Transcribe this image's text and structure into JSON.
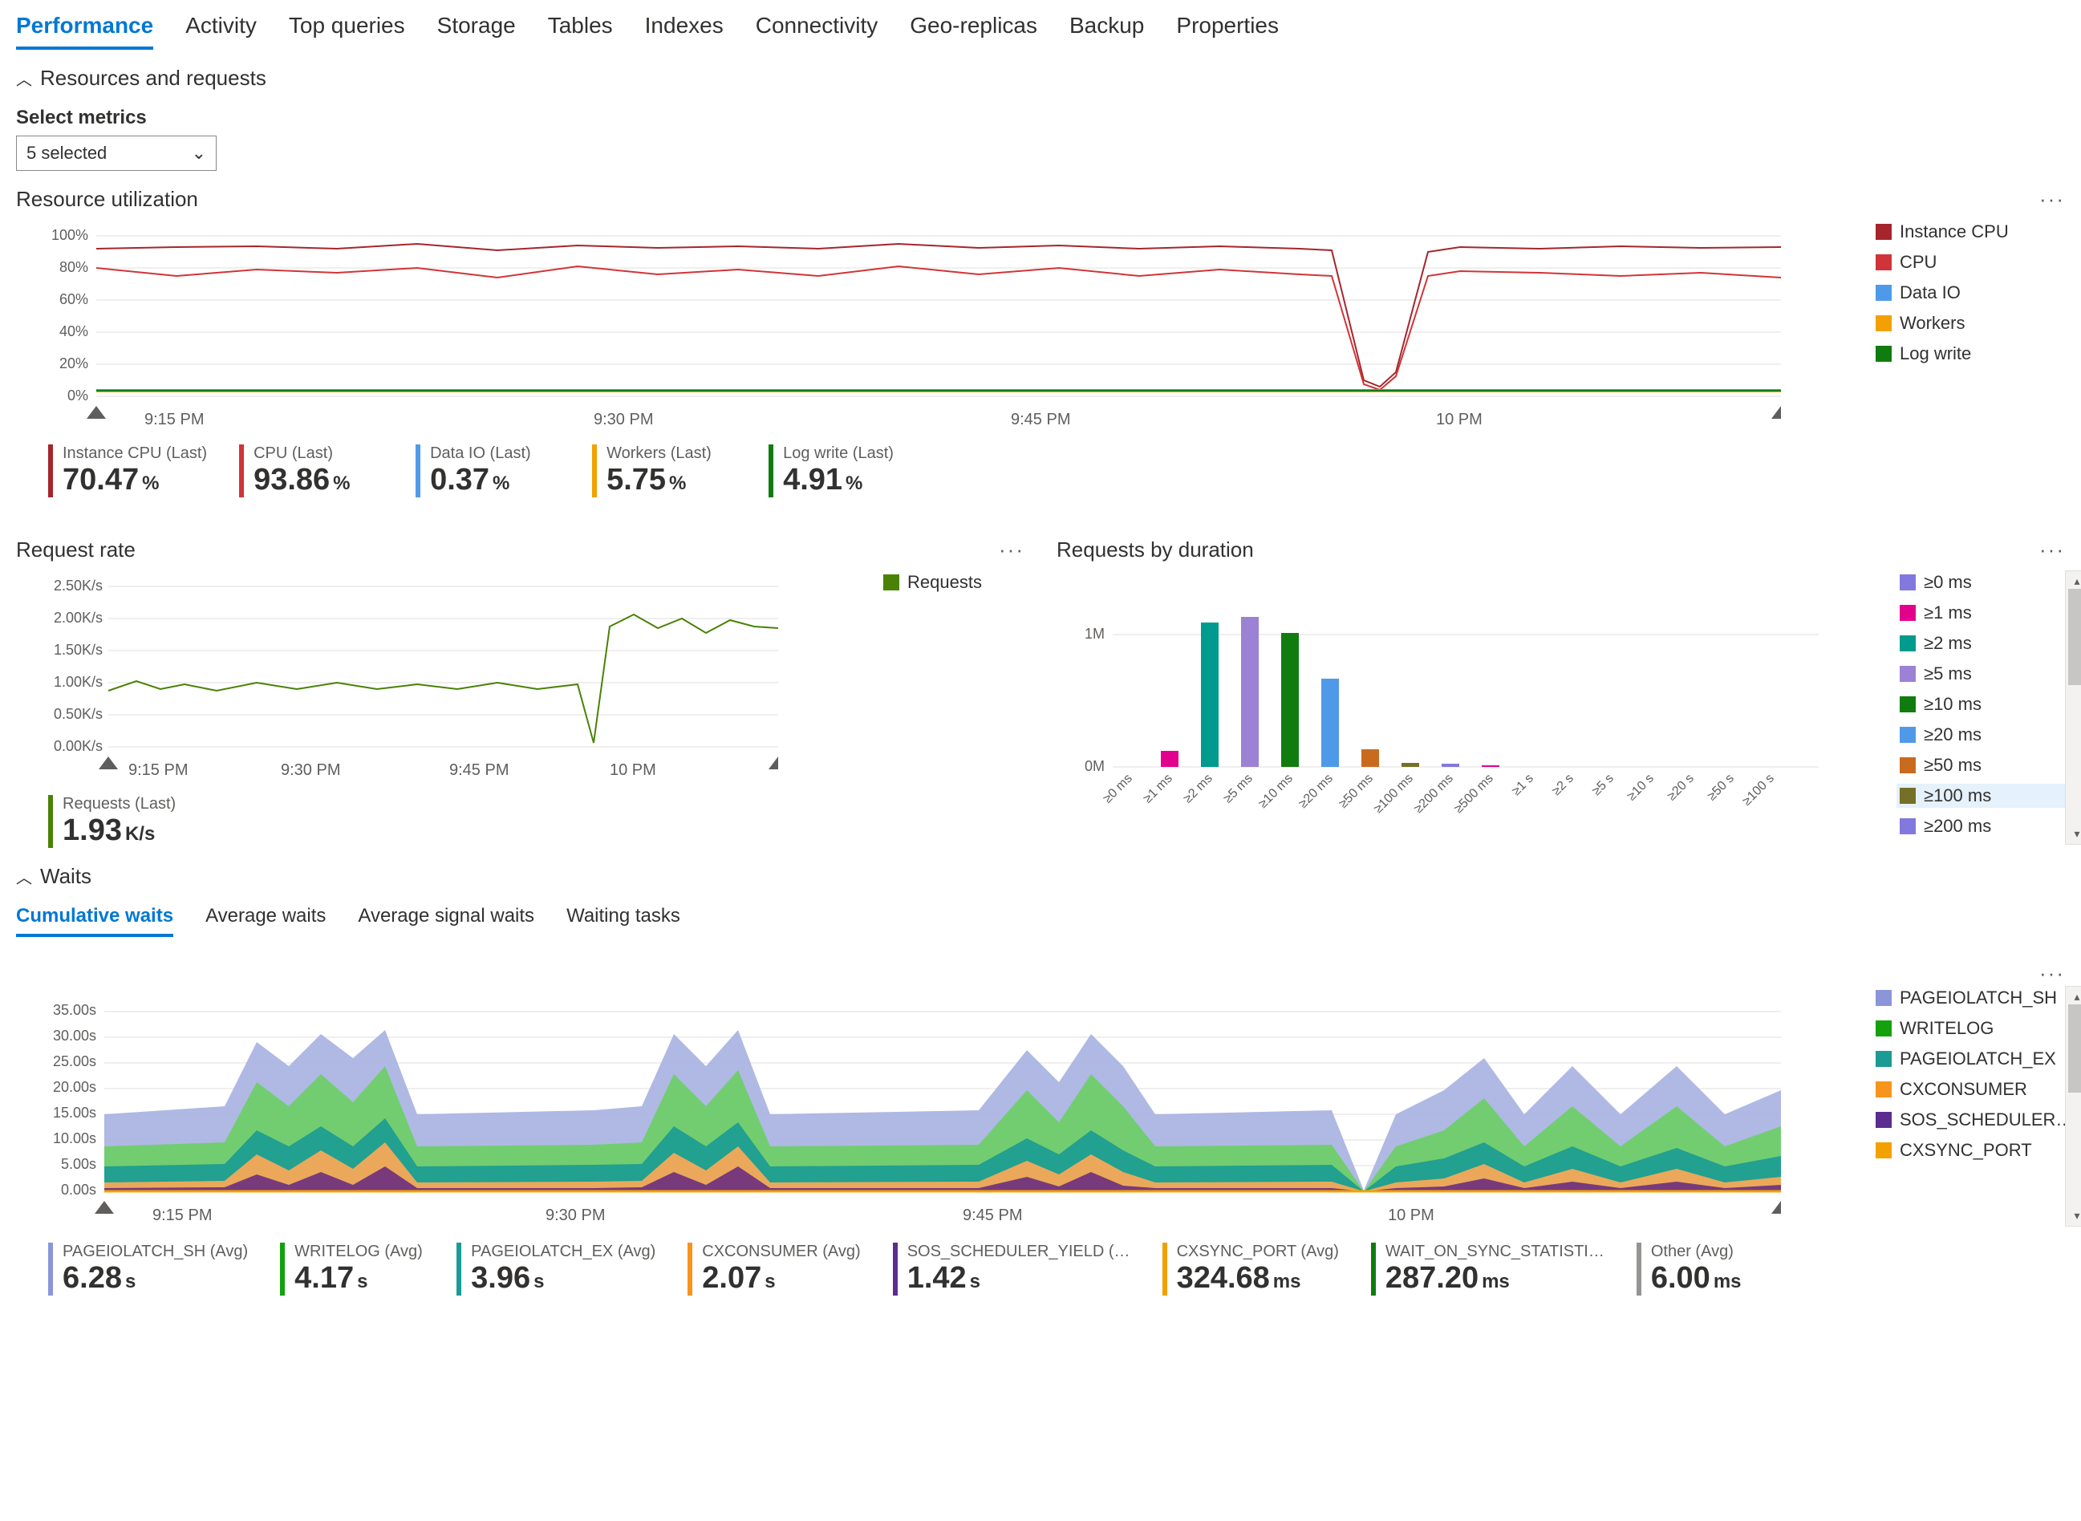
{
  "tabs": [
    "Performance",
    "Activity",
    "Top queries",
    "Storage",
    "Tables",
    "Indexes",
    "Connectivity",
    "Geo-replicas",
    "Backup",
    "Properties"
  ],
  "active_tab": "Performance",
  "sections": {
    "resources": {
      "title": "Resources and requests",
      "select_label": "Select metrics",
      "select_value": "5 selected"
    },
    "waits": {
      "title": "Waits"
    }
  },
  "wait_subtabs": [
    "Cumulative waits",
    "Average waits",
    "Average signal waits",
    "Waiting tasks"
  ],
  "wait_subtab_active": "Cumulative waits",
  "resource_util": {
    "title": "Resource utilization",
    "legend": [
      {
        "label": "Instance CPU",
        "color": "#a4262c"
      },
      {
        "label": "CPU",
        "color": "#d13438"
      },
      {
        "label": "Data IO",
        "color": "#4f9ae8"
      },
      {
        "label": "Workers",
        "color": "#f2a100"
      },
      {
        "label": "Log write",
        "color": "#107c10"
      }
    ],
    "metrics": [
      {
        "label": "Instance CPU (Last)",
        "value": "70.47",
        "unit": "%",
        "color": "#a4262c"
      },
      {
        "label": "CPU (Last)",
        "value": "93.86",
        "unit": "%",
        "color": "#d13438"
      },
      {
        "label": "Data IO (Last)",
        "value": "0.37",
        "unit": "%",
        "color": "#4f9ae8"
      },
      {
        "label": "Workers (Last)",
        "value": "5.75",
        "unit": "%",
        "color": "#f2a100"
      },
      {
        "label": "Log write (Last)",
        "value": "4.91",
        "unit": "%",
        "color": "#107c10"
      }
    ],
    "xlabels": [
      "9:15 PM",
      "9:30 PM",
      "9:45 PM",
      "10 PM"
    ],
    "yticks": [
      "0%",
      "20%",
      "40%",
      "60%",
      "80%",
      "100%"
    ]
  },
  "request_rate": {
    "title": "Request rate",
    "legend": [
      {
        "label": "Requests",
        "color": "#498205"
      }
    ],
    "metrics": [
      {
        "label": "Requests (Last)",
        "value": "1.93",
        "unit": "K/s",
        "color": "#498205"
      }
    ],
    "xlabels": [
      "9:15 PM",
      "9:30 PM",
      "9:45 PM",
      "10 PM"
    ],
    "yticks": [
      "0.00K/s",
      "0.50K/s",
      "1.00K/s",
      "1.50K/s",
      "2.00K/s",
      "2.50K/s"
    ]
  },
  "requests_by_duration": {
    "title": "Requests by duration",
    "legend": [
      {
        "label": "≥0 ms",
        "color": "#8378de"
      },
      {
        "label": "≥1 ms",
        "color": "#e3008c"
      },
      {
        "label": "≥2 ms",
        "color": "#009b8e"
      },
      {
        "label": "≥5 ms",
        "color": "#9b82d4"
      },
      {
        "label": "≥10 ms",
        "color": "#107c10"
      },
      {
        "label": "≥20 ms",
        "color": "#4f9ae8"
      },
      {
        "label": "≥50 ms",
        "color": "#c96b1f"
      },
      {
        "label": "≥100 ms",
        "color": "#757028",
        "hl": true
      },
      {
        "label": "≥200 ms",
        "color": "#8378de"
      }
    ],
    "yticks": [
      "0M",
      "1M"
    ],
    "xlabels": [
      "≥0 ms",
      "≥1 ms",
      "≥2 ms",
      "≥5 ms",
      "≥10 ms",
      "≥20 ms",
      "≥50 ms",
      "≥100 ms",
      "≥200 ms",
      "≥500 ms",
      "≥1 s",
      "≥2 s",
      "≥5 s",
      "≥10 s",
      "≥20 s",
      "≥50 s",
      "≥100 s"
    ]
  },
  "waits_chart": {
    "legend": [
      {
        "label": "PAGEIOLATCH_SH",
        "color": "#8a96d9"
      },
      {
        "label": "WRITELOG",
        "color": "#13a10e"
      },
      {
        "label": "PAGEIOLATCH_EX",
        "color": "#1a9b94"
      },
      {
        "label": "CXCONSUMER",
        "color": "#f7941d"
      },
      {
        "label": "SOS_SCHEDULER…",
        "color": "#5b2d8e"
      },
      {
        "label": "CXSYNC_PORT",
        "color": "#f2a100"
      }
    ],
    "xlabels": [
      "9:15 PM",
      "9:30 PM",
      "9:45 PM",
      "10 PM"
    ],
    "yticks": [
      "0.00s",
      "5.00s",
      "10.00s",
      "15.00s",
      "20.00s",
      "25.00s",
      "30.00s",
      "35.00s"
    ],
    "metrics": [
      {
        "label": "PAGEIOLATCH_SH (Avg)",
        "value": "6.28",
        "unit": "s",
        "color": "#8a96d9"
      },
      {
        "label": "WRITELOG (Avg)",
        "value": "4.17",
        "unit": "s",
        "color": "#13a10e"
      },
      {
        "label": "PAGEIOLATCH_EX (Avg)",
        "value": "3.96",
        "unit": "s",
        "color": "#1a9b94"
      },
      {
        "label": "CXCONSUMER (Avg)",
        "value": "2.07",
        "unit": "s",
        "color": "#f7941d"
      },
      {
        "label": "SOS_SCHEDULER_YIELD (…",
        "value": "1.42",
        "unit": "s",
        "color": "#5b2d8e"
      },
      {
        "label": "CXSYNC_PORT (Avg)",
        "value": "324.68",
        "unit": "ms",
        "color": "#f2a100"
      },
      {
        "label": "WAIT_ON_SYNC_STATISTI…",
        "value": "287.20",
        "unit": "ms",
        "color": "#107c10"
      },
      {
        "label": "Other (Avg)",
        "value": "6.00",
        "unit": "ms",
        "color": "#959493"
      }
    ]
  },
  "chart_data": [
    {
      "type": "line",
      "title": "Resource utilization",
      "ylabel": "%",
      "ylim": [
        0,
        100
      ],
      "x_time_range": [
        "9:10 PM",
        "10:10 PM"
      ],
      "series": [
        {
          "name": "Instance CPU",
          "approx_avg": 92,
          "dip_at": "9:58 PM",
          "dip_value": 5
        },
        {
          "name": "CPU",
          "approx_avg": 78,
          "dip_at": "9:58 PM",
          "dip_value": 5
        },
        {
          "name": "Data IO",
          "approx_avg": 3
        },
        {
          "name": "Workers",
          "approx_avg": 4
        },
        {
          "name": "Log write",
          "approx_avg": 4
        }
      ]
    },
    {
      "type": "line",
      "title": "Request rate",
      "ylabel": "K/s",
      "ylim": [
        0,
        2.5
      ],
      "series": [
        {
          "name": "Requests",
          "phase1_avg": 1.0,
          "phase1_end": "9:57 PM",
          "dip_value": 0.05,
          "phase2_avg": 1.9
        }
      ]
    },
    {
      "type": "bar",
      "title": "Requests by duration",
      "ylabel": "count",
      "ylim": [
        0,
        1200000
      ],
      "categories": [
        "≥0 ms",
        "≥1 ms",
        "≥2 ms",
        "≥5 ms",
        "≥10 ms",
        "≥20 ms",
        "≥50 ms",
        "≥100 ms",
        "≥200 ms",
        "≥500 ms",
        "≥1 s",
        "≥2 s",
        "≥5 s",
        "≥10 s",
        "≥20 s",
        "≥50 s",
        "≥100 s"
      ],
      "values": [
        0,
        120000,
        1080000,
        1120000,
        1000000,
        650000,
        130000,
        30000,
        25000,
        10000,
        0,
        0,
        0,
        0,
        0,
        0,
        0
      ]
    },
    {
      "type": "area",
      "title": "Cumulative waits",
      "ylabel": "s",
      "ylim": [
        0,
        35
      ],
      "series_names": [
        "PAGEIOLATCH_SH",
        "WRITELOG",
        "PAGEIOLATCH_EX",
        "CXCONSUMER",
        "SOS_SCHEDULER_YIELD",
        "CXSYNC_PORT",
        "WAIT_ON_SYNC_STATISTICS",
        "Other"
      ],
      "avg_values_s": [
        6.28,
        4.17,
        3.96,
        2.07,
        1.42,
        0.32468,
        0.2872,
        0.006
      ]
    }
  ]
}
